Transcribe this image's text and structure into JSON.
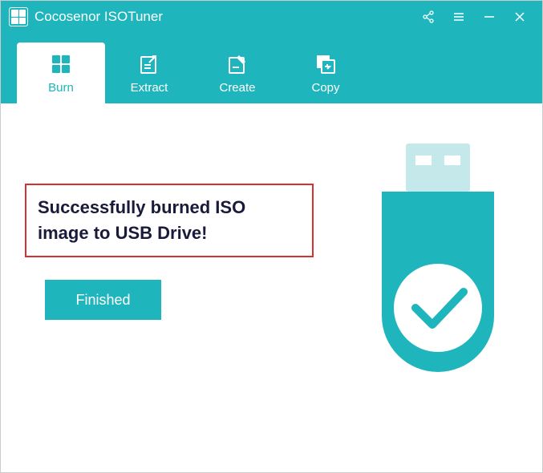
{
  "titlebar": {
    "app_name": "Cocosenor ISOTuner"
  },
  "tabs": [
    {
      "label": "Burn",
      "active": true,
      "icon": "burn-icon"
    },
    {
      "label": "Extract",
      "active": false,
      "icon": "extract-icon"
    },
    {
      "label": "Create",
      "active": false,
      "icon": "create-icon"
    },
    {
      "label": "Copy",
      "active": false,
      "icon": "copy-icon"
    }
  ],
  "main": {
    "message": "Successfully burned ISO image to USB Drive!",
    "button_label": "Finished"
  },
  "colors": {
    "accent": "#1fb5bc",
    "highlight_border": "#d63030"
  }
}
